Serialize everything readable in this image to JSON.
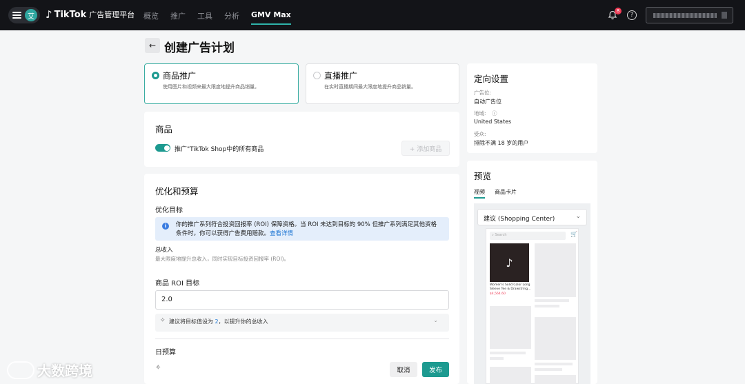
{
  "topbar": {
    "avatar_initial": "艾",
    "brand_name": "TikTok",
    "brand_sub": "广告管理平台",
    "nav": [
      "概览",
      "推广",
      "工具",
      "分析",
      "GMV Max"
    ],
    "notification_count": "8"
  },
  "header": {
    "title": "创建广告计划"
  },
  "promo_types": [
    {
      "title": "商品推广",
      "desc": "使用图片和视频来最大限度地提升商品销量。",
      "selected": true
    },
    {
      "title": "直播推广",
      "desc": "在实时直播期间最大限度地提升商品销量。",
      "selected": false
    }
  ],
  "products": {
    "title": "商品",
    "toggle_label": "推广\"TikTok Shop中的所有商品",
    "add_button": "+ 添加商品"
  },
  "optimization": {
    "title": "优化和预算",
    "goal_label": "优化目标",
    "info_text": "你的推广系列符合投资回报率 (ROI) 保障资格。当 ROI 未达到目标的 90% 但推广系列满足其他资格条件时，你可以获得广告费用赔款。",
    "info_link": "查看详情",
    "gross_revenue": "总收入",
    "gross_revenue_desc": "最大限度地提升总收入，同时实现目标投资回报率 (ROI)。",
    "roi_label": "商品 ROI 目标",
    "roi_value": "2.0",
    "hint_prefix": "建议将目标值设为 ",
    "hint_value": "2",
    "hint_suffix": "，以提升你的总收入",
    "daily_budget": "日预算",
    "cancel": "取消",
    "publish": "发布"
  },
  "targeting": {
    "title": "定向设置",
    "placement_label": "广告位:",
    "placement_value": "自动广告位",
    "region_label": "地域:",
    "region_value": "United States",
    "audience_label": "受众:",
    "audience_value": "排除不满 18 岁的用户"
  },
  "preview": {
    "title": "预览",
    "tabs": [
      "视频",
      "商品卡片"
    ],
    "select_value": "建议 (Shopping Center)",
    "search_placeholder": "Search",
    "product_name": "Women's Solid Color Long Sleeve Tee & Drawstring...",
    "product_price": "$4,564.60"
  },
  "watermark": "大数跨境",
  "colors": {
    "accent": "#1d9a90",
    "topbar": "#131418",
    "info_bg": "#e4eefb"
  }
}
